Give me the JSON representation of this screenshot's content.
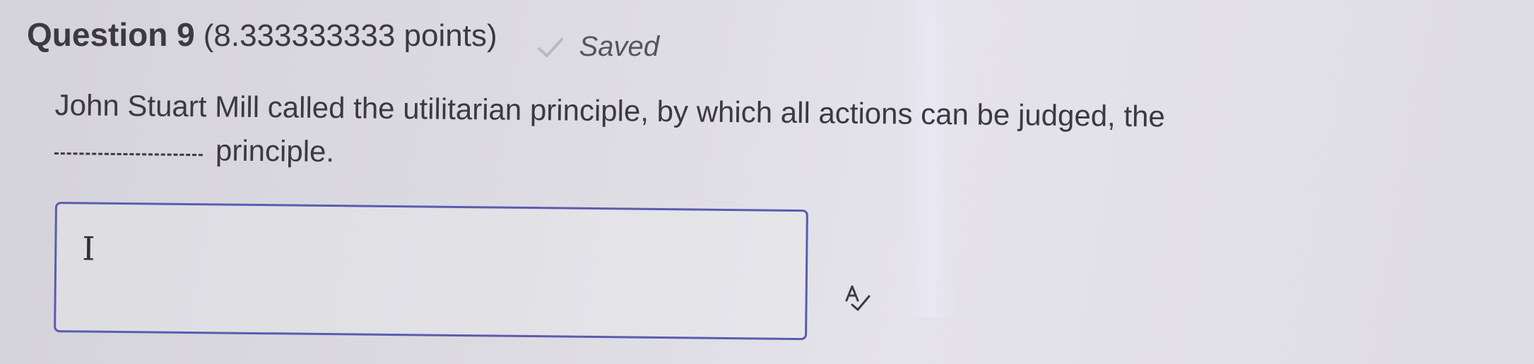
{
  "question": {
    "title": "Question 9",
    "points": "(8.333333333 points)",
    "status": "Saved",
    "status_icon": "check-icon",
    "text": "John Stuart Mill called the utilitarian principle, by which all actions can be judged, the",
    "text_after_blank": "principle."
  },
  "answer": {
    "value": "",
    "placeholder": "",
    "cursor_icon": "text-cursor-icon",
    "cursor_glyph": "I"
  },
  "toolbar": {
    "spellcheck_icon": "spellcheck-icon"
  },
  "colors": {
    "accent": "#5b5bb0",
    "text": "#3a3a40",
    "status": "#55555b"
  }
}
